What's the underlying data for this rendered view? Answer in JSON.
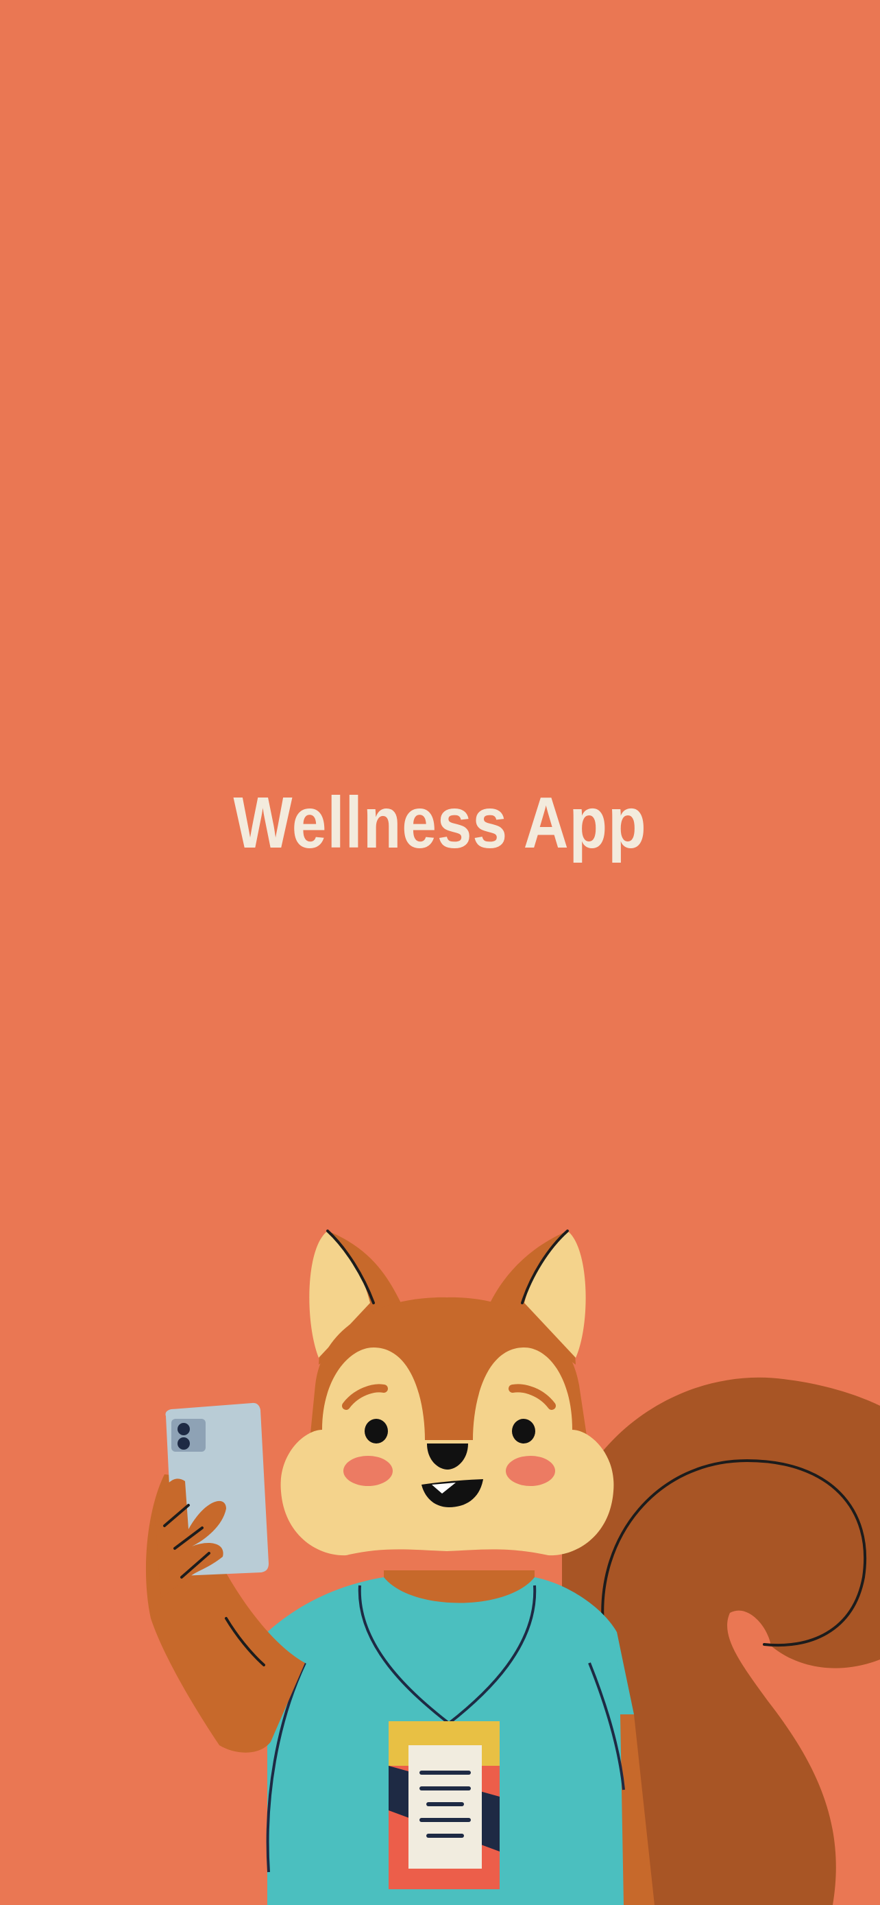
{
  "splash": {
    "title": "Wellness App",
    "mascot": "squirrel-with-phone-illustration"
  },
  "colors": {
    "background": "#EA7753",
    "title_text": "#F3EBDD",
    "fur": "#C7692B",
    "tail": "#A85525",
    "face": "#F4D38C",
    "shirt": "#4BBFBF",
    "phone": "#B9CCD6"
  }
}
